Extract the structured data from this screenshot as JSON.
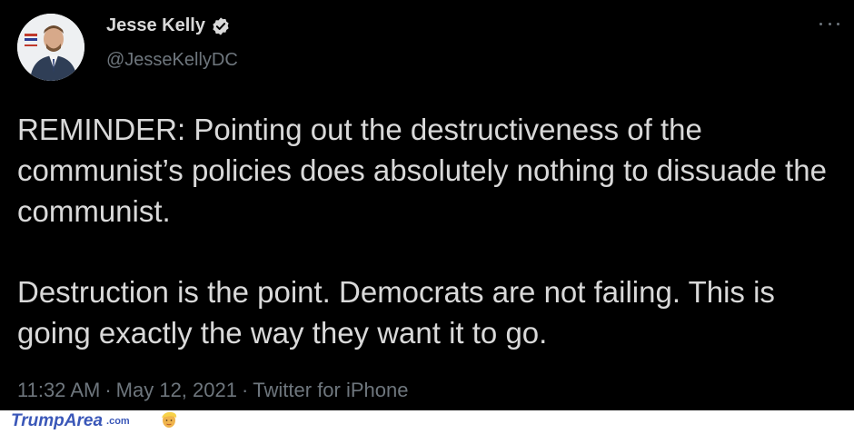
{
  "author": {
    "name": "Jesse Kelly",
    "handle": "@JesseKellyDC",
    "verified": true
  },
  "tweet": {
    "paragraphs": [
      "REMINDER: Pointing out the destructiveness of the communist’s policies does absolutely nothing to dissuade the communist.",
      "Destruction is the point. Democrats are not failing. This is going exactly the way they want it to go."
    ],
    "time": "11:32 AM",
    "separator": "·",
    "date": "May 12, 2021",
    "source": "Twitter for iPhone"
  },
  "watermark": {
    "brand": "TrumpArea",
    "suffix": ".com"
  },
  "icons": {
    "verified": "verified-badge-icon",
    "more": "more-options-icon",
    "watermark_logo": "trump-face-icon"
  },
  "colors": {
    "background": "#000000",
    "text": "#d9d9d9",
    "muted": "#6e767d",
    "watermark": "#3a57b8"
  }
}
